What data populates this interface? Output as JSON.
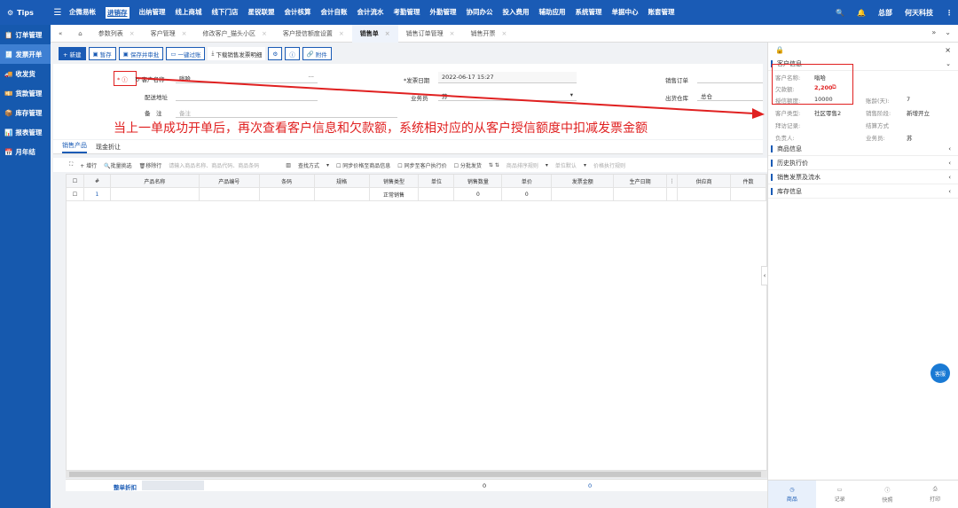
{
  "topbar": {
    "brand": "Tips",
    "nav": [
      "企微易帐",
      "进销存",
      "出纳管理",
      "线上商城",
      "线下门店",
      "星锐联盟",
      "会计核算",
      "会计自账",
      "会计流水",
      "考勤管理",
      "外勤管理",
      "协同办公",
      "投入费用",
      "辅助应用",
      "系统管理",
      "单据中心",
      "账套管理"
    ],
    "active_nav": "进销存",
    "right": [
      "总部",
      "何天科技"
    ]
  },
  "sidebar": {
    "items": [
      "订单管理",
      "发票开单",
      "收发货",
      "货款管理",
      "库存管理",
      "报表管理",
      "月年结"
    ],
    "active": "发票开单"
  },
  "tabs": [
    "参数列表",
    "客户管理",
    "修改客户_猫头小区",
    "客户授信额度设置",
    "销售单",
    "销售订单管理",
    "销售开票"
  ],
  "active_tab": "销售单",
  "toolbar": {
    "new": "+ 新建",
    "temp_save": "暂存",
    "save_audit": "保存并审批",
    "one_click": "一键过账",
    "download": "下载销售发票明细",
    "attach": "附件"
  },
  "form": {
    "customer_label": "客户名称",
    "customer_value": "嗡哈",
    "address_label": "配送地址",
    "remark_label": "备　注",
    "remark_placeholder": "备注",
    "invoice_date_label": "*发票日期",
    "invoice_date_value": "2022-06-17 15:27",
    "salesman_label": "业务员",
    "salesman_value": "苏",
    "sales_order_label": "销售订单",
    "warehouse_label": "出货仓库",
    "warehouse_value": "总仓"
  },
  "annotation": "当上一单成功开单后，再次查看客户信息和欠款额，系统相对应的从客户授信额度中扣减发票金额",
  "subtabs": [
    "销售产品",
    "现金折让"
  ],
  "grid_toolbar": {
    "add_row": "+ 增行",
    "batch": "批量挑选",
    "delete": "移除行",
    "search_placeholder": "请输入商品名称、商品代码、商品条码",
    "find": "查找方式",
    "sync_price": "同步价格至商品信息",
    "sync_exec": "同步至客户执行价",
    "batch_ship": "分批发货",
    "sort_rule": "商品排序规则",
    "unit_default": "单位默认",
    "price_rule": "价格执行规则"
  },
  "grid": {
    "headers": [
      "",
      "#",
      "产品名称",
      "产品编号",
      "条码",
      "规格",
      "销售类型",
      "单位",
      "销售数量",
      "单价",
      "发票金额",
      "生产日期",
      "",
      "供应商",
      "件数"
    ],
    "rows": [
      [
        "",
        "1",
        "",
        "",
        "",
        "",
        "正常销售",
        "",
        "0",
        "0",
        "",
        "",
        "",
        "",
        ""
      ]
    ]
  },
  "footer": {
    "label": "整单折扣",
    "qty": "0",
    "amount": "0"
  },
  "rpanel": {
    "sections": [
      {
        "title": "客户信息",
        "open": true
      },
      {
        "title": "商品信息"
      },
      {
        "title": "历史执行价"
      },
      {
        "title": "销售发票及流水"
      },
      {
        "title": "库存信息"
      }
    ],
    "customer": {
      "name_label": "客户名称:",
      "name": "嗡哈",
      "debt_label": "欠款额:",
      "debt": "2,200",
      "credit_label": "授信额度:",
      "credit": "10000",
      "age_label": "账龄(天):",
      "age": "7",
      "type_label": "客户类型:",
      "type": "社区零售2",
      "stage_label": "销售阶段:",
      "stage": "新增开立",
      "visit_label": "拜访记录:",
      "settle_label": "结算方式",
      "owner_label": "负责人:",
      "salesman_label": "业务员:",
      "salesman": "苏"
    },
    "bottom": [
      "商品",
      "记录",
      "快照",
      "打印"
    ]
  },
  "kefu": "客服",
  "colors": {
    "brand": "#1a5bb5",
    "sidebar": "#1659ae",
    "alert": "#e02020"
  }
}
